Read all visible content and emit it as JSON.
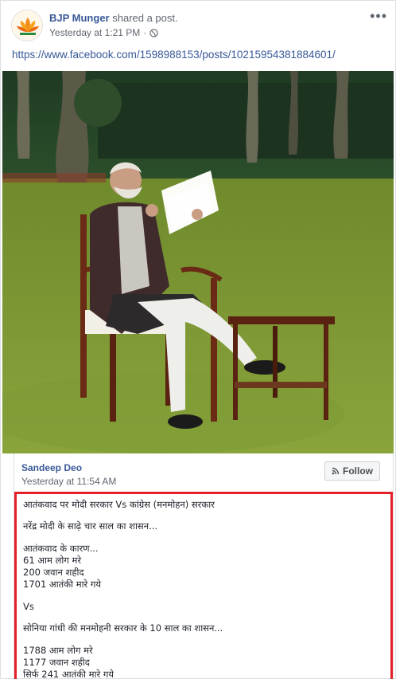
{
  "header": {
    "author": "BJP Munger",
    "action": "shared a post.",
    "timestamp": "Yesterday at 1:21 PM",
    "separator": "·",
    "more": "•••"
  },
  "post_link": "https://www.facebook.com/1598988153/posts/10215954381884601/",
  "shared_post": {
    "author": "Sandeep Deo",
    "timestamp": "Yesterday at 11:54 AM",
    "follow_label": "Follow",
    "lines": [
      "आतंकवाद पर मोदी सरकार Vs कांग्रेस (मनमोहन) सरकार",
      "नरेंद्र मोदी के साढ़े चार साल का शासन...",
      "आतंकवाद के कारण...",
      "61 आम लोग मरे",
      "200 जवान शहीद",
      "1701 आतंकी मारे गये",
      "Vs",
      "सोनिया गांधी की मनमोहनी सरकार के 10 साल का शासन...",
      "1788 आम लोग मरे",
      "1177 जवान शहीद",
      "सिर्फ 241 आतंकी मारे गये"
    ]
  },
  "colors": {
    "link": "#385898",
    "highlight_border": "#e4202a",
    "meta_text": "#616770"
  }
}
